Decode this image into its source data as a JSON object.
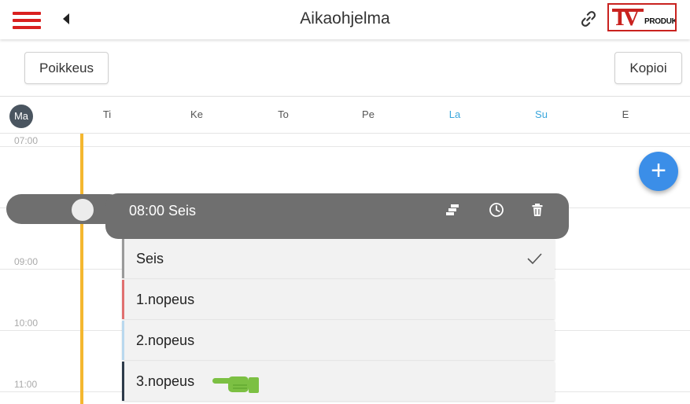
{
  "header": {
    "title": "Aikaohjelma",
    "logo_text": "IV PRODUKT",
    "icons": [
      "menu-icon",
      "back-icon",
      "link-icon"
    ]
  },
  "toolbar": {
    "exception_label": "Poikkeus",
    "copy_label": "Kopioi"
  },
  "days": [
    {
      "label": "Ma",
      "active": true
    },
    {
      "label": "Ti"
    },
    {
      "label": "Ke"
    },
    {
      "label": "To"
    },
    {
      "label": "Pe"
    },
    {
      "label": "La",
      "weekend": true
    },
    {
      "label": "Su",
      "weekend": true
    },
    {
      "label": "E"
    }
  ],
  "times": [
    "07:00",
    "09:00",
    "10:00",
    "11:00"
  ],
  "event": {
    "label": "08:00 Seis",
    "icons": [
      "bars-icon",
      "clock-icon",
      "trash-icon"
    ]
  },
  "options": [
    {
      "label": "Seis",
      "selected": true,
      "color": "#9a9a9a"
    },
    {
      "label": "1.nopeus",
      "color": "#e07070"
    },
    {
      "label": "2.nopeus",
      "color": "#b9d8ee"
    },
    {
      "label": "3.nopeus",
      "color": "#2d3a4a"
    }
  ],
  "colors": {
    "accent": "#3b8ee8",
    "timeline": "#f4b730",
    "menu": "#d9201f",
    "weekend": "#3aa6dc",
    "pill": "#6f6f6f",
    "pointer_hand": "#7cc043"
  }
}
